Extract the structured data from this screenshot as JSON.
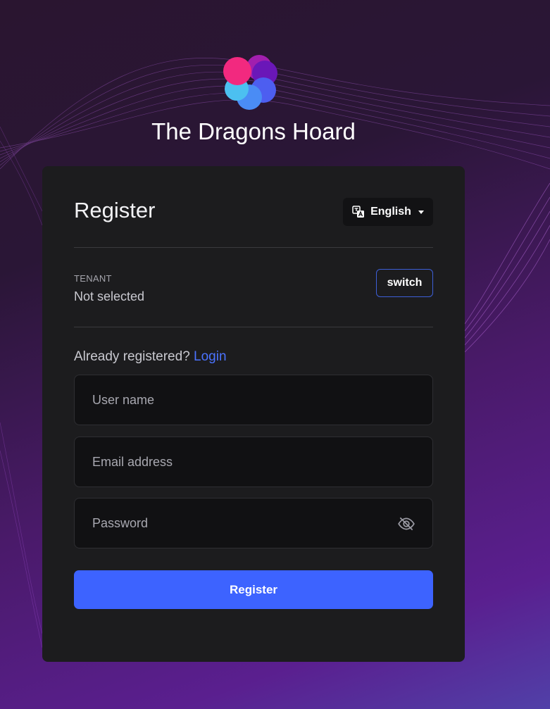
{
  "app": {
    "title": "The Dragons Hoard"
  },
  "card": {
    "title": "Register"
  },
  "language": {
    "label": "English",
    "icon": "translate-icon"
  },
  "tenant": {
    "label": "TENANT",
    "value": "Not selected",
    "switch_label": "switch"
  },
  "login_prompt": {
    "text": "Already registered?",
    "link": "Login"
  },
  "form": {
    "username_placeholder": "User name",
    "email_placeholder": "Email address",
    "password_placeholder": "Password",
    "submit_label": "Register"
  },
  "colors": {
    "accent": "#3d63ff",
    "link": "#4b73ff",
    "card_bg": "#1c1c1e",
    "logo": [
      "#f2297f",
      "#a21fae",
      "#6a17b8",
      "#4d5ef0",
      "#4a8cf5",
      "#4cc0f0"
    ]
  }
}
